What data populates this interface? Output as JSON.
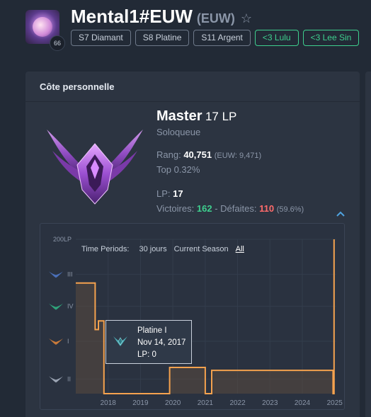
{
  "profile": {
    "name": "Mental1#EUW",
    "region": "(EUW)",
    "level": "66",
    "tags": [
      {
        "label": "S7 Diamant",
        "kind": "season"
      },
      {
        "label": "S8 Platine",
        "kind": "season"
      },
      {
        "label": "S11 Argent",
        "kind": "season"
      },
      {
        "label": "<3 Lulu",
        "kind": "fav"
      },
      {
        "label": "<3 Lee Sin",
        "kind": "fav"
      }
    ]
  },
  "card": {
    "title": "Côte personnelle",
    "tier": "Master",
    "lp_text": "17 LP",
    "queue": "Soloqueue",
    "rank_label": "Rang:",
    "rank_value": "40,751",
    "rank_region": "(EUW: 9,471)",
    "top": "Top 0.32%",
    "lp_label": "LP:",
    "lp_value": "17",
    "wins_label": "Victoires:",
    "wins": "162",
    "dash": "-",
    "losses_label": "Défaites:",
    "losses": "110",
    "winrate": "(59.6%)"
  },
  "periods": {
    "label": "Time Periods:",
    "options": [
      "30 jours",
      "Current Season",
      "All"
    ],
    "active": "All"
  },
  "chart_data": {
    "type": "line",
    "ylabels": [
      "200LP",
      "III",
      "IV",
      "I",
      "II"
    ],
    "xticks": [
      "2018",
      "2019",
      "2020",
      "2021",
      "2022",
      "2023",
      "2024",
      "2025"
    ],
    "series": [
      {
        "values": [
          {
            "date": "2017.0",
            "level": 3.8
          },
          {
            "date": "2017.6",
            "level": 3.8
          },
          {
            "date": "2017.6",
            "level": 2.2
          },
          {
            "date": "2017.7",
            "level": 2.2
          },
          {
            "date": "2017.7",
            "level": 2.5
          },
          {
            "date": "2017.87",
            "level": 2.5
          },
          {
            "date": "2017.87",
            "level": 0.0
          },
          {
            "date": "2019.9",
            "level": 0.0
          },
          {
            "date": "2019.9",
            "level": 0.9
          },
          {
            "date": "2021.0",
            "level": 0.9
          },
          {
            "date": "2021.0",
            "level": 0.0
          },
          {
            "date": "2021.2",
            "level": 0.0
          },
          {
            "date": "2021.2",
            "level": 0.8
          },
          {
            "date": "2024.95",
            "level": 0.8
          },
          {
            "date": "2024.95",
            "level": 0.0
          },
          {
            "date": "2024.98",
            "level": 0.0
          },
          {
            "date": "2024.98",
            "level": 5.3
          }
        ]
      }
    ],
    "colors": {
      "line": "#f5a24e",
      "fill": "#5a4a3e"
    }
  },
  "tooltip": {
    "tier": "Platine I",
    "date": "Nov 14, 2017",
    "lp": "LP: 0"
  },
  "colors": {
    "win": "#3ecf8e",
    "loss": "#ff6b6b",
    "accent": "#4fa3e0"
  }
}
